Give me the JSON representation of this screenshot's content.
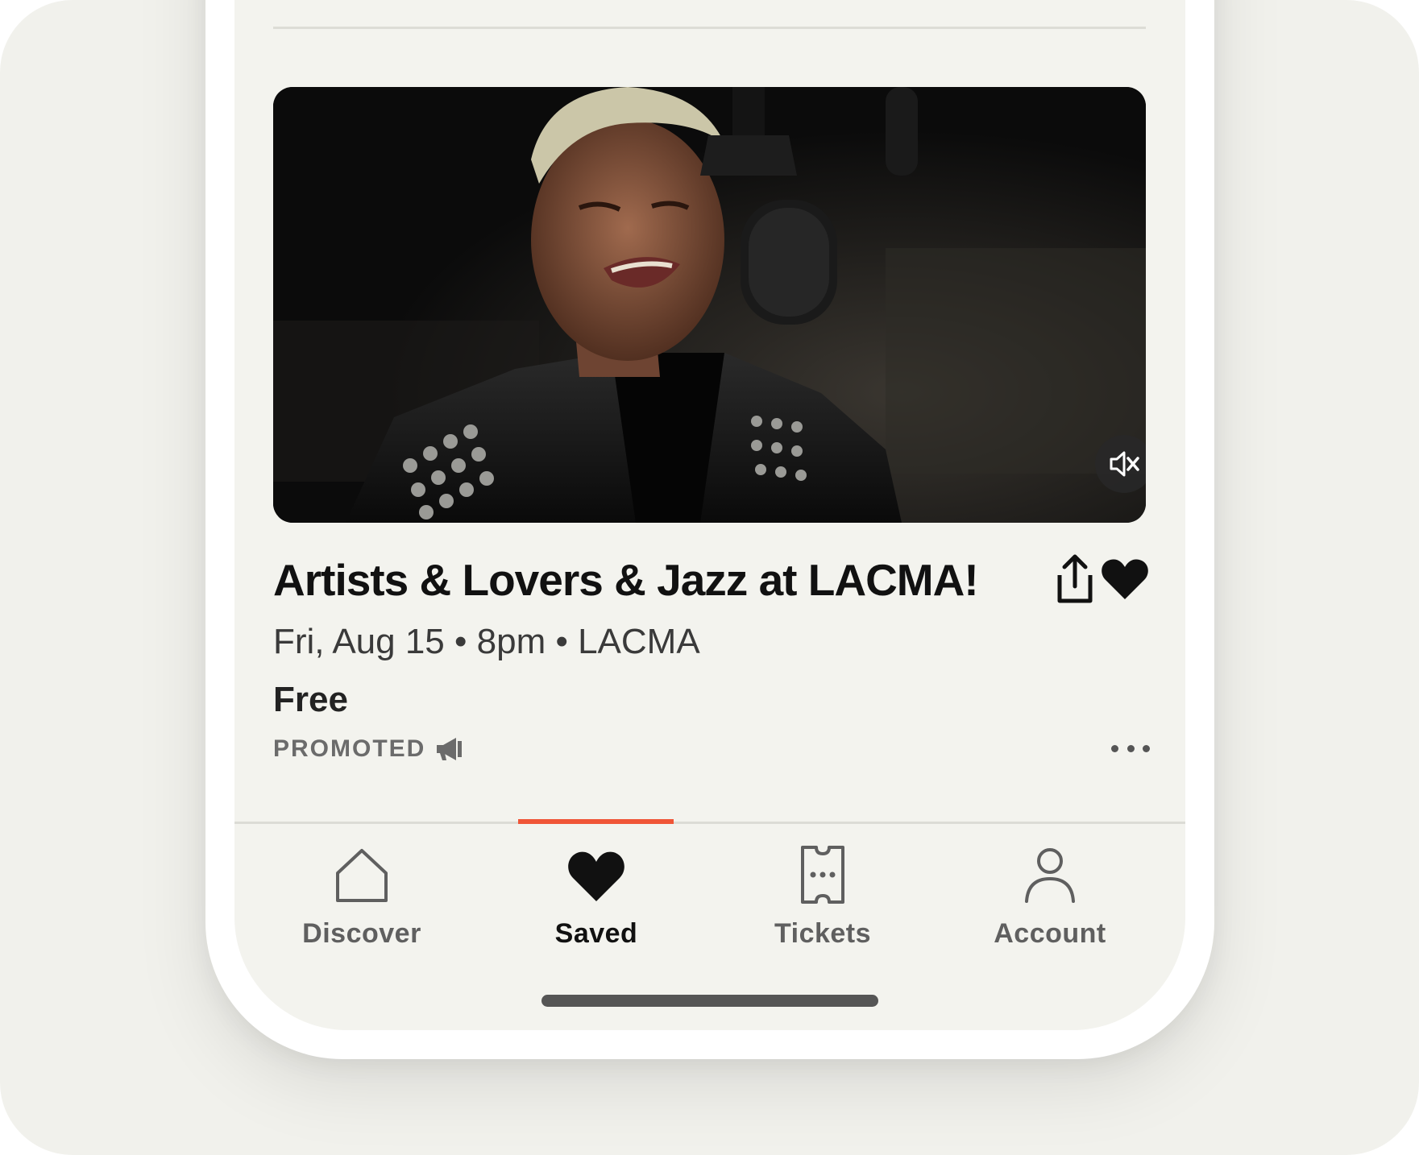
{
  "event": {
    "title": "Artists & Lovers & Jazz at LACMA!",
    "meta": "Fri, Aug 15 • 8pm • LACMA",
    "price": "Free",
    "promoted_label": "PROMOTED"
  },
  "media": {
    "mute_icon": "speaker-muted-icon"
  },
  "tabs": [
    {
      "label": "Discover",
      "icon": "house-icon",
      "active": false
    },
    {
      "label": "Saved",
      "icon": "heart-icon",
      "active": true
    },
    {
      "label": "Tickets",
      "icon": "ticket-icon",
      "active": false
    },
    {
      "label": "Account",
      "icon": "person-icon",
      "active": false
    }
  ],
  "colors": {
    "accent": "#f05537",
    "background": "#f3f3ee",
    "text": "#111111",
    "muted": "#6b6b6b"
  }
}
